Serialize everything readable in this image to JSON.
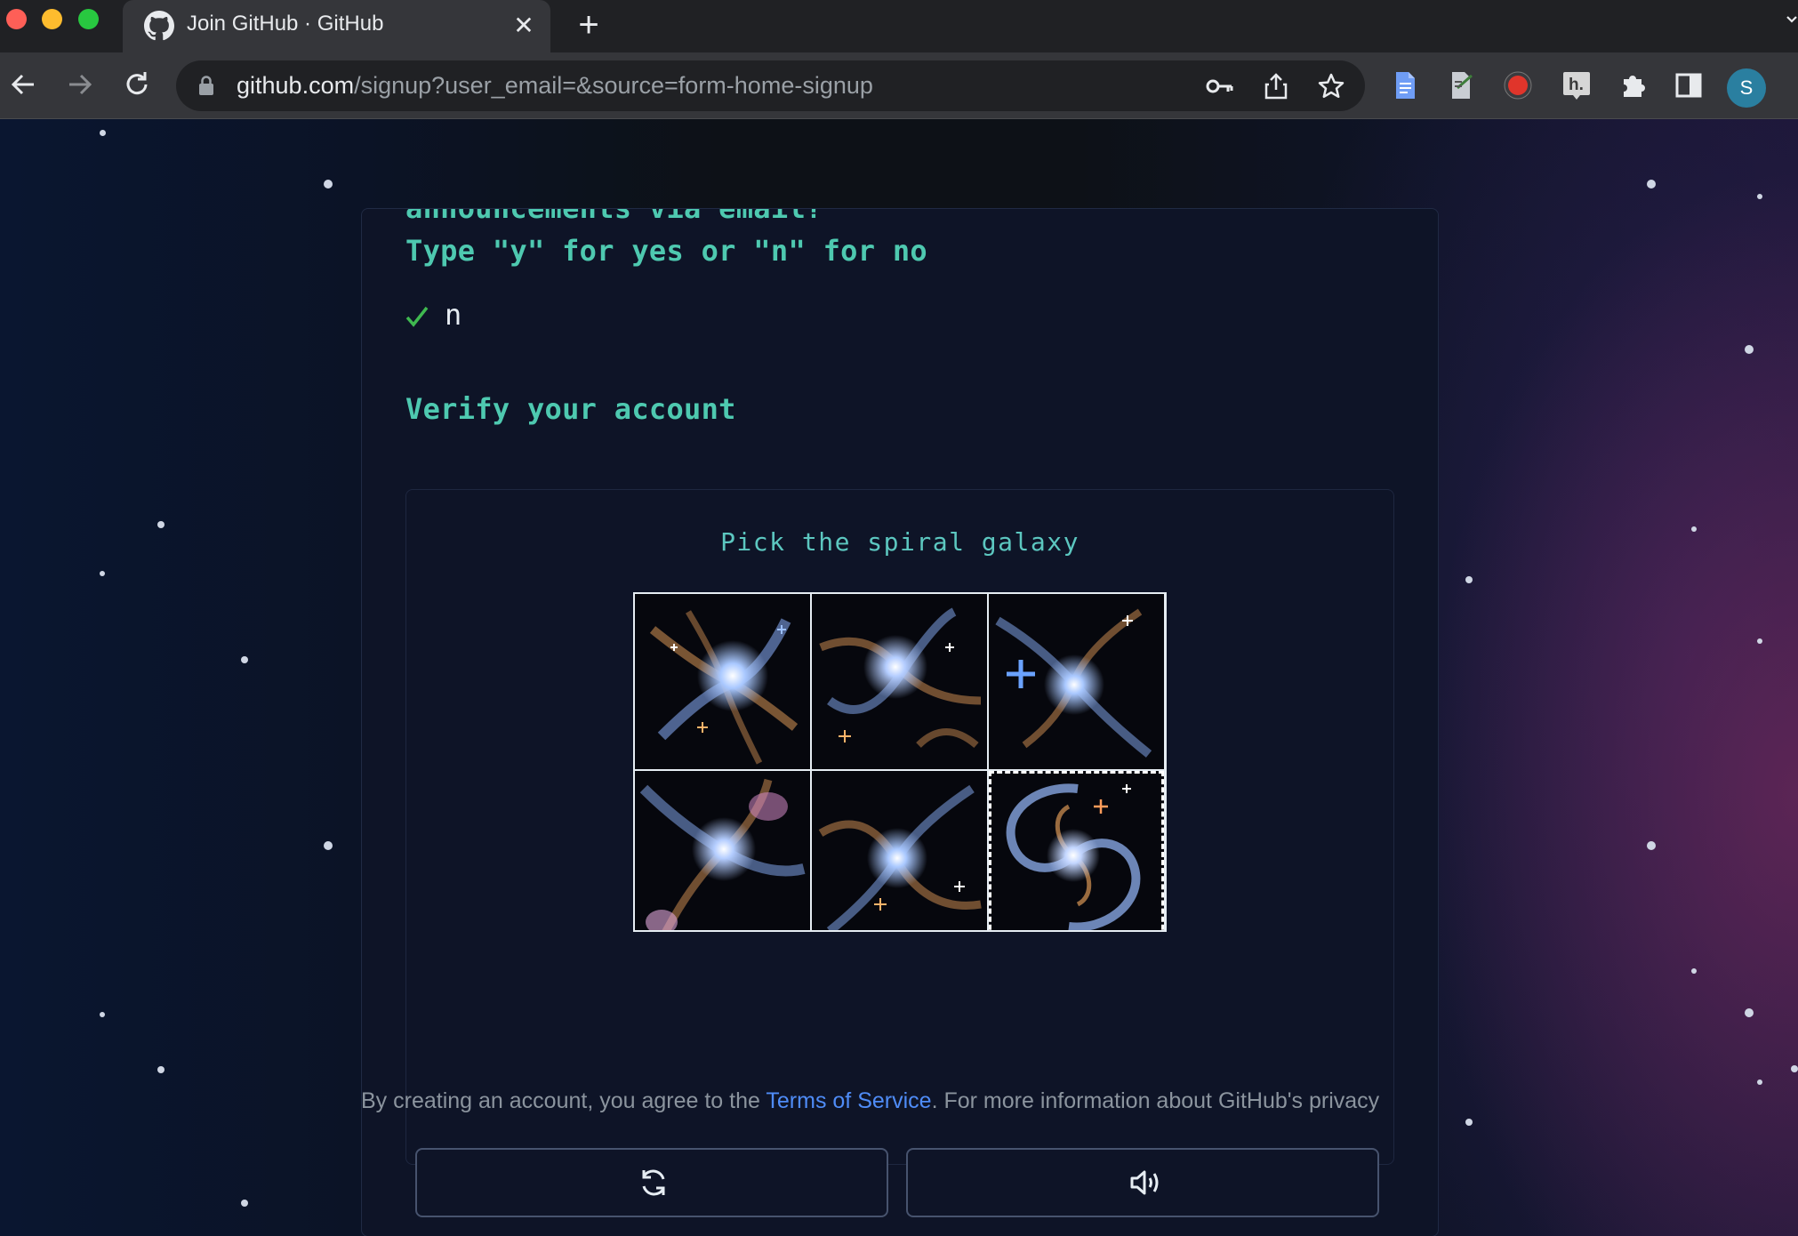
{
  "browser": {
    "tab_title": "Join GitHub · GitHub",
    "tab_close": "✕",
    "new_tab": "+",
    "url_host": "github.com",
    "url_path": "/signup?user_email=&source=form-home-signup",
    "profile_initial": "S"
  },
  "form": {
    "previous_question_tail": "announcements via email?",
    "question_prompt": "Type \"y\" for yes or \"n\" for no",
    "answer": "n",
    "verify_heading": "Verify your account"
  },
  "captcha": {
    "instruction": "Pick the spiral galaxy",
    "tiles": [
      {
        "label": "galaxy-1",
        "selected": false
      },
      {
        "label": "galaxy-2",
        "selected": false
      },
      {
        "label": "galaxy-3",
        "selected": false
      },
      {
        "label": "galaxy-4",
        "selected": false
      },
      {
        "label": "galaxy-5",
        "selected": false
      },
      {
        "label": "spiral-galaxy",
        "selected": true
      }
    ],
    "buttons": [
      "refresh-icon",
      "audio-icon"
    ]
  },
  "footer": {
    "text_before": "By creating an account, you agree to the ",
    "link": "Terms of Service",
    "text_after": ". For more information about GitHub's privacy"
  },
  "colors": {
    "accent_teal": "#4ec9b0",
    "check_green": "#3fb950",
    "link_blue": "#4f8cf7",
    "page_bg": "#0d1117"
  }
}
